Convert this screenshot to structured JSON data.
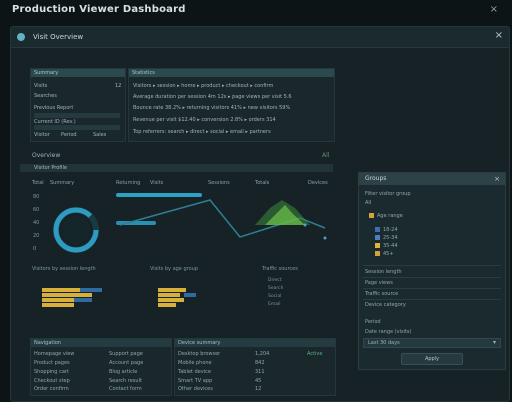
{
  "header": {
    "title": "Production Viewer Dashboard",
    "close_label": "×"
  },
  "window": {
    "title": "Visit Overview",
    "close_label": "×"
  },
  "summary_panel": {
    "title": "Summary",
    "rows": [
      {
        "label": "Visits",
        "value": "12"
      },
      {
        "label": "Searches",
        "value": ""
      },
      {
        "label": "Previous Report",
        "value": ""
      },
      {
        "label": "Current ID (Rev.)",
        "value": ""
      }
    ],
    "footer": [
      "Visitor",
      "Period",
      "Sales"
    ]
  },
  "details_panel": {
    "title": "Statistics",
    "lines": [
      "Visitors ▸ session ▸ home ▸ product ▸ checkout ▸ confirm",
      "Average duration per session 4m 12s ▸ page views per visit 5.6",
      "Bounce rate 38.2% ▸ returning visitors 41% ▸ new visitors 59%",
      "Revenue per visit $12.40 ▸ conversion 2.8% ▸ orders 314",
      "Top referrers: search ▸ direct ▸ social ▸ email ▸ partners"
    ]
  },
  "activity": {
    "section_title": "Overview",
    "section_right": "All",
    "tab_label": "Visitor Profile",
    "tabs": [
      "Total",
      "Summary",
      "Returning",
      "Visits",
      "Sessions",
      "Totals",
      "Devices"
    ]
  },
  "charts": {
    "yaxis": [
      "80",
      "60",
      "40",
      "20",
      "0"
    ],
    "captions": [
      "Visitors by session length",
      "Visits by age group",
      "Traffic sources"
    ],
    "mini_legend": [
      "Direct",
      "Search",
      "Social",
      "Email"
    ]
  },
  "bottom_left": {
    "title": "Navigation",
    "items": [
      "Homepage view",
      "Product pages",
      "Shopping cart",
      "Checkout step",
      "Order confirm",
      "Support page",
      "Account page",
      "Blog article",
      "Search result",
      "Contact form"
    ]
  },
  "bottom_right": {
    "title": "Device summary",
    "items": [
      "Desktop browser",
      "Mobile phone",
      "Tablet device",
      "Smart TV app",
      "Other devices",
      "1,204",
      "842",
      "311",
      "45",
      "12"
    ],
    "badge": "Active"
  },
  "side_panel": {
    "title": "Groups",
    "close_label": "×",
    "section": "Filter visitor group",
    "sub": "All",
    "legend_title": "Age range",
    "legend": [
      {
        "label": "18-24",
        "color": "#3c6fb0"
      },
      {
        "label": "25-34",
        "color": "#4b7fc2"
      },
      {
        "label": "35-44",
        "color": "#e0b43a"
      },
      {
        "label": "45+",
        "color": "#d3a23a"
      }
    ],
    "rows": [
      "Session length",
      "Page views",
      "Traffic source",
      "Device category"
    ],
    "filter_label": "Period",
    "filter_sub": "Date range (visits)",
    "select_value": "Last 30 days",
    "button": "Apply"
  },
  "colors": {
    "accent": "#3fb0c9",
    "yellow": "#d9b23b",
    "green": "#5fae5a"
  }
}
